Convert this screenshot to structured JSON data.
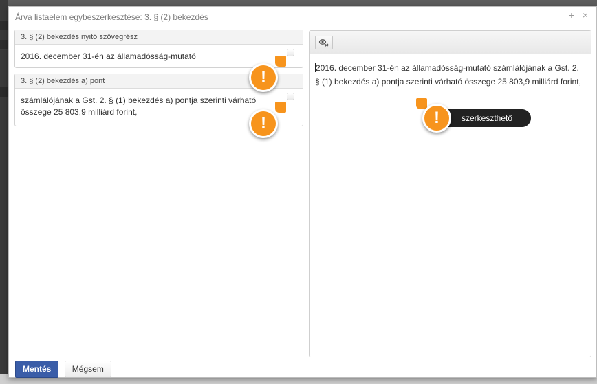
{
  "dialog": {
    "title": "Árva listaelem egybeszerkesztése: 3. § (2) bekezdés",
    "maximize_glyph": "+",
    "close_glyph": "×"
  },
  "left_panels": [
    {
      "header": "3. § (2) bekezdés nyitó szövegrész",
      "body": "2016. december 31-én az államadósság-mutató",
      "checked": false
    },
    {
      "header": "3. § (2) bekezdés a) pont",
      "body": "számlálójának a Gst. 2. § (1) bekezdés a) pontja szerinti várható összege 25 803,9 milliárd forint,",
      "checked": false
    }
  ],
  "editor": {
    "toolbar_icon": "clear-formatting-icon",
    "text": "2016. december 31-én az államadósság-mutató számlálójának a Gst. 2. § (1) bekezdés a) pontja szerinti várható összege 25 803,9 milliárd forint,"
  },
  "hints": {
    "glyph": "!",
    "editor_tooltip": "szerkeszthető",
    "color": "#f7941d"
  },
  "footer": {
    "save_label": "Mentés",
    "cancel_label": "Mégsem"
  },
  "colors": {
    "primary": "#3a5da8",
    "tooltip_bg": "#222222"
  }
}
